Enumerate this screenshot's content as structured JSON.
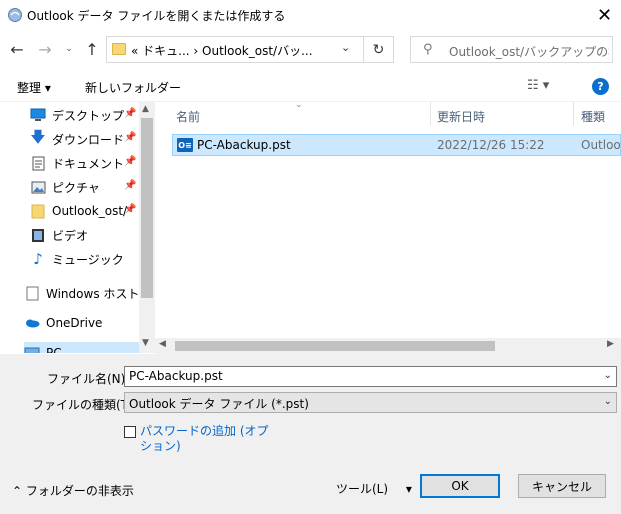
{
  "window": {
    "title": "Outlook データ ファイルを開くまたは作成する",
    "close_glyph": "✕"
  },
  "address": {
    "path": "« ドキュ...  ›  Outlook_ost/バッ...",
    "search_placeholder": "Outlook_ost/バックアップの検索"
  },
  "toolbar": {
    "organize_label": "整理 ▾",
    "new_folder_label": "新しいフォルダー"
  },
  "nav": {
    "items": [
      {
        "label": "デスクトップ",
        "icon": "desktop-icon",
        "pinned": true
      },
      {
        "label": "ダウンロード",
        "icon": "download-icon",
        "pinned": true
      },
      {
        "label": "ドキュメント",
        "icon": "documents-icon",
        "pinned": true
      },
      {
        "label": "ピクチャ",
        "icon": "pictures-icon",
        "pinned": true
      },
      {
        "label": "Outlook_ost/",
        "icon": "folder-icon",
        "pinned": true
      },
      {
        "label": "ビデオ",
        "icon": "video-icon",
        "pinned": false
      },
      {
        "label": "ミュージック",
        "icon": "music-icon",
        "pinned": false
      },
      {
        "label": "Windows ホスト プ",
        "icon": "document-icon",
        "pinned": false
      },
      {
        "label": "OneDrive",
        "icon": "onedrive-icon",
        "pinned": false
      },
      {
        "label": "PC",
        "icon": "pc-icon",
        "pinned": false
      }
    ]
  },
  "file_list": {
    "columns": [
      "名前",
      "更新日時",
      "種類"
    ],
    "rows": [
      {
        "name": "PC-Abackup.pst",
        "modified": "2022/12/26 15:22",
        "type": "Outlook"
      }
    ]
  },
  "form": {
    "filename_label": "ファイル名(N):",
    "filename_value": "PC-Abackup.pst",
    "filetype_label": "ファイルの種類(T):",
    "filetype_value": "Outlook データ ファイル (*.pst)",
    "password_label": "パスワードの追加 (オプション)",
    "hide_folders_label": "フォルダーの非表示",
    "tools_label": "ツール(L)",
    "ok_label": "OK",
    "cancel_label": "キャンセル"
  },
  "colors": {
    "accent": "#0078d7",
    "selection": "#cce8ff",
    "help": "#0b6fd0"
  }
}
